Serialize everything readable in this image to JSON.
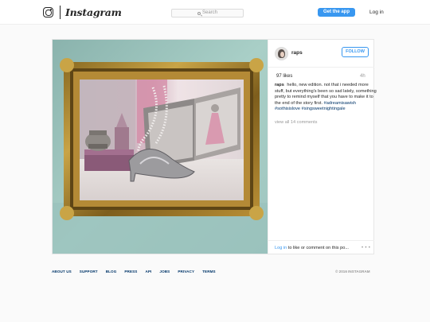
{
  "header": {
    "logo_text": "Instagram",
    "search_placeholder": "Search",
    "get_app_label": "Get the app",
    "login_label": "Log in"
  },
  "post": {
    "username": "raps",
    "follow_label": "FOLLOW",
    "likes": "97 likes",
    "age": "4h",
    "caption_username": "raps",
    "caption_text": "hello, new edition. not that i needed more stuff, but everything's been so sad lately, something pretty to remind myself that you have to make it to the end of the story first.",
    "hashtags": [
      "#adreamisawish",
      "#sothisislove",
      "#singsweetnightingale"
    ],
    "view_comments": "view all 14 comments",
    "login_link": "Log in",
    "login_rest": " to like or comment on this po..."
  },
  "footer": {
    "links": [
      "ABOUT US",
      "SUPPORT",
      "BLOG",
      "PRESS",
      "API",
      "JOBS",
      "PRIVACY",
      "TERMS"
    ],
    "copyright": "© 2016 INSTAGRAM"
  },
  "colors": {
    "accent": "#3897f0",
    "link_dark": "#003569",
    "background": "#fafafa"
  },
  "icons": [
    "instagram-camera-icon",
    "search-icon",
    "more-options-icon"
  ]
}
